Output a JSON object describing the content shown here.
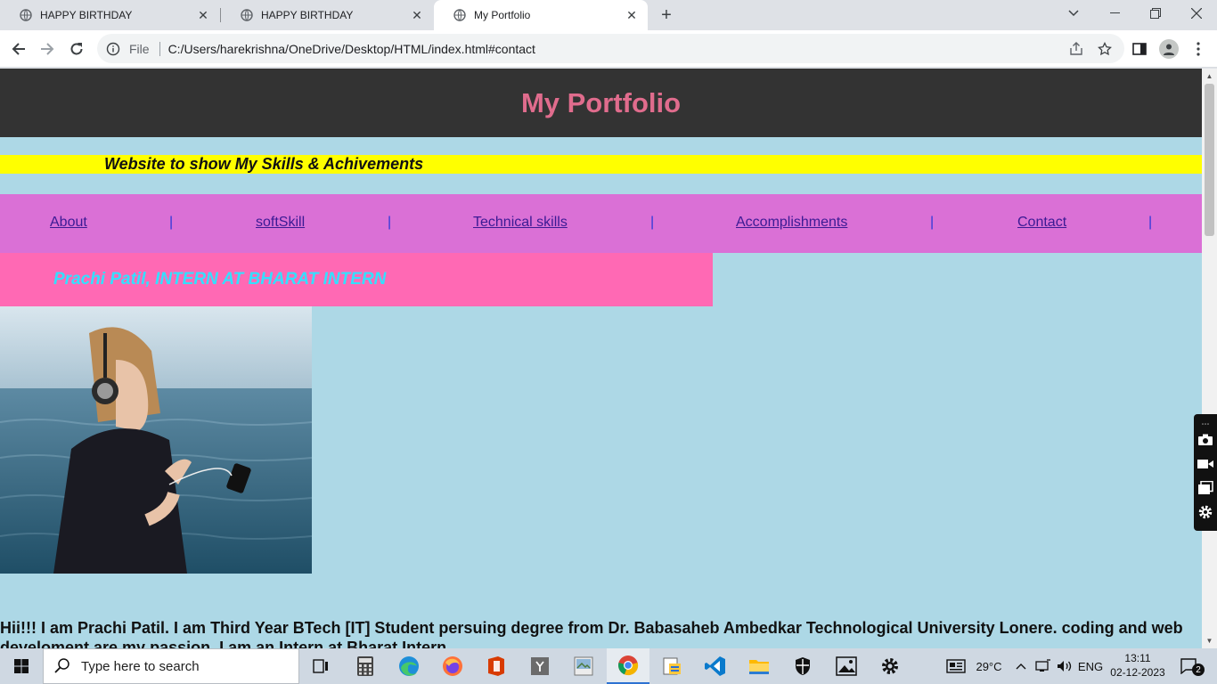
{
  "browser": {
    "tabs": [
      {
        "title": "HAPPY BIRTHDAY",
        "active": false
      },
      {
        "title": "HAPPY BIRTHDAY",
        "active": false
      },
      {
        "title": "My Portfolio",
        "active": true
      }
    ],
    "address": {
      "scheme_label": "File",
      "url": "C:/Users/harekrishna/OneDrive/Desktop/HTML/index.html#contact"
    }
  },
  "site": {
    "title": "My Portfolio",
    "tagline": "Website to show My Skills & Achivements",
    "nav": [
      {
        "label": "About"
      },
      {
        "label": "softSkill"
      },
      {
        "label": "Technical skills"
      },
      {
        "label": "Accomplishments"
      },
      {
        "label": "Contact"
      }
    ],
    "nav_separator": "|",
    "name_banner": "Prachi Patil, INTERN AT BHARAT INTERN",
    "bio": "Hii!!! I am Prachi Patil. I am Third Year BTech [IT] Student persuing degree from Dr. Babasaheb Ambedkar Technological University Lonere. coding and web develoment are my passion. I am an Intern at Bharat Intern"
  },
  "taskbar": {
    "search_placeholder": "Type here to search",
    "apps": [
      "task-view-icon",
      "calculator-icon",
      "edge-icon",
      "firefox-icon",
      "office-icon",
      "notepad-icon",
      "photo-viewer-icon",
      "chrome-icon",
      "file-manager-icon",
      "vscode-icon",
      "file-explorer-icon",
      "security-icon",
      "photos-icon",
      "settings-icon"
    ],
    "tray": {
      "temperature": "29°C",
      "language": "ENG",
      "time": "13:11",
      "date": "02-12-2023",
      "notification_count": "2"
    }
  },
  "colors": {
    "header_bg": "#333333",
    "title_pink": "#e06c8d",
    "page_bg": "#add8e6",
    "tagline_bg": "#ffff00",
    "nav_bg": "#da70d6",
    "banner_bg": "#ff69b4",
    "banner_text": "#33e0ff"
  }
}
